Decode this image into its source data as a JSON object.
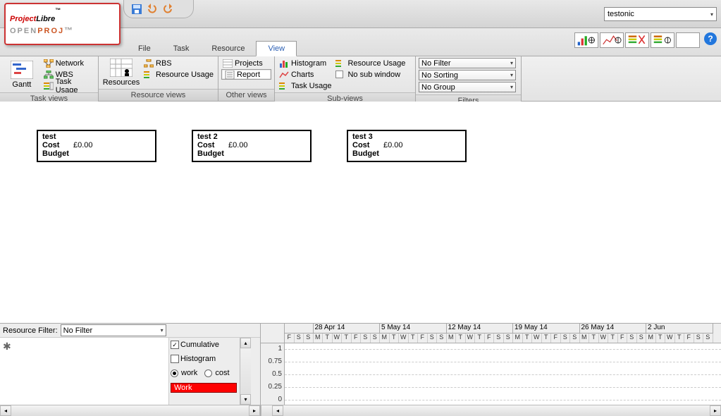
{
  "window": {
    "project_name": "testonic"
  },
  "logo": {
    "top1": "Project",
    "top2": "Libre",
    "tm": "™",
    "bottom1": "OPEN",
    "bottom2": "PROJ"
  },
  "quick_access": {
    "save_icon": "save-icon",
    "undo_icon": "undo-icon",
    "redo_icon": "redo-icon"
  },
  "menus": [
    "File",
    "Task",
    "Resource",
    "View"
  ],
  "menu_selected_index": 3,
  "help_label": "?",
  "ribbon": {
    "task_views": {
      "label": "Task views",
      "gantt": "Gantt",
      "items": [
        "Network",
        "WBS",
        "Task Usage"
      ]
    },
    "resource_views": {
      "label": "Resource views",
      "resources": "Resources",
      "items": [
        "RBS",
        "Resource Usage"
      ]
    },
    "other_views": {
      "label": "Other views",
      "items": [
        "Projects",
        "Report"
      ],
      "selected_index": 1
    },
    "sub_views": {
      "label": "Sub-views",
      "col1": [
        "Histogram",
        "Charts",
        "Task Usage"
      ],
      "col2": [
        "Resource Usage",
        "No sub window"
      ]
    },
    "filters": {
      "label": "Filters",
      "filter": "No Filter",
      "sorting": "No Sorting",
      "group": "No Group"
    }
  },
  "task_nodes": [
    {
      "name": "test",
      "cost_label": "Cost",
      "cost": "£0.00",
      "budget_label": "Budget",
      "budget": ""
    },
    {
      "name": "test 2",
      "cost_label": "Cost",
      "cost": "£0.00",
      "budget_label": "Budget",
      "budget": ""
    },
    {
      "name": "test 3",
      "cost_label": "Cost",
      "cost": "£0.00",
      "budget_label": "Budget",
      "budget": ""
    }
  ],
  "bottom": {
    "resource_filter_label": "Resource Filter:",
    "resource_filter_value": "No Filter",
    "resource_list_item": "✱",
    "options": {
      "cumulative": "Cumulative",
      "cumulative_checked": true,
      "histogram": "Histogram",
      "histogram_checked": false,
      "work": "work",
      "cost": "cost",
      "radio_selected": "work",
      "work_bar": "Work"
    },
    "timeline": {
      "weeks": [
        "28 Apr 14",
        "5 May 14",
        "12 May 14",
        "19 May 14",
        "26 May 14",
        "2 Jun"
      ],
      "pre_days": [
        "F",
        "S",
        "S"
      ],
      "week_days": [
        "M",
        "T",
        "W",
        "T",
        "F",
        "S",
        "S"
      ]
    },
    "chart_data": {
      "type": "line",
      "title": "",
      "xlabel": "",
      "ylabel": "",
      "ylim": [
        0,
        1
      ],
      "yticks": [
        0,
        0.25,
        0.5,
        0.75,
        1
      ],
      "series": [
        {
          "name": "Work",
          "values": []
        }
      ],
      "categories": []
    }
  }
}
